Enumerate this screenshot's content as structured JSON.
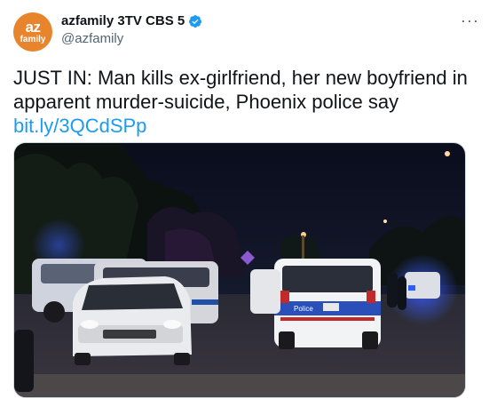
{
  "author": {
    "avatar_text_top": "az",
    "avatar_text_bottom": "family",
    "display_name": "azfamily 3TV CBS 5",
    "handle": "@azfamily",
    "verified": true
  },
  "more_label": "···",
  "tweet": {
    "text": "JUST IN: Man kills ex-girlfriend, her new boyfriend in apparent murder-suicide, Phoenix police say",
    "link": "bit.ly/3QCdSPp"
  },
  "media": {
    "police_car_label": "Police"
  },
  "colors": {
    "avatar": "#e8842c",
    "link": "#1d9bf0",
    "verified": "#1d9bf0"
  }
}
